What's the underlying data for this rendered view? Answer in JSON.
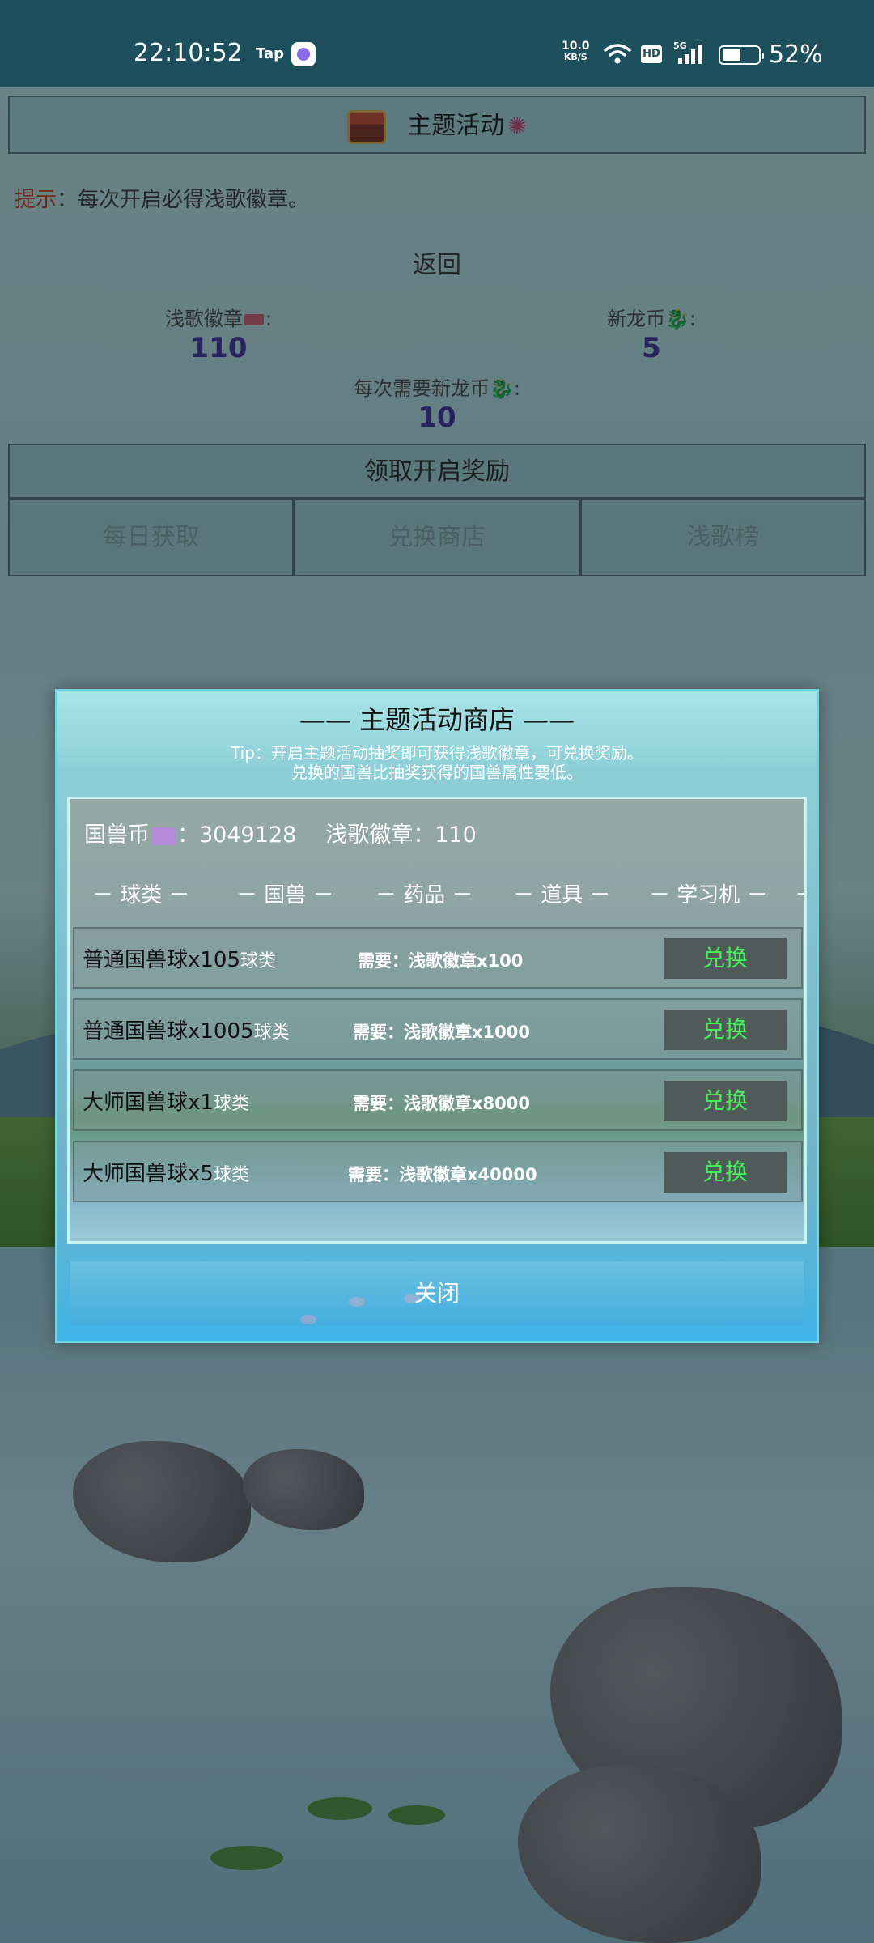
{
  "status_bar": {
    "time": "22:10:52",
    "tap_label": "Tap",
    "net_speed_value": "10.0",
    "net_speed_unit": "KB/S",
    "hd_badge": "HD",
    "signal_label": "5G",
    "battery_percent": "52%",
    "battery_level": 0.52
  },
  "page": {
    "header_title": "主题活动",
    "tip_label": "提示",
    "tip_text": "：每次开启必得浅歌徽章。",
    "back_label": "返回",
    "badge_label": "浅歌徽章",
    "badge_value": "110",
    "dragon_coin_label": "新龙币",
    "dragon_coin_value": "5",
    "cost_label": "每次需要新龙币",
    "cost_value": "10",
    "claim_button": "领取开启奖励",
    "tabs": [
      "每日获取",
      "兑换商店",
      "浅歌榜"
    ]
  },
  "modal": {
    "title": "—— 主题活动商店 ——",
    "tip_line1": "Tip：开启主题活动抽奖即可获得浅歌徽章，可兑换奖励。",
    "tip_line2": "兑换的国兽比抽奖获得的国兽属性要低。",
    "coin_label": "国兽币",
    "coin_value": "：3049128",
    "badge_label": "浅歌徽章：110",
    "categories": [
      "－ 球类 －",
      "－ 国兽 －",
      "－ 药品 －",
      "－ 道具 －",
      "－ 学习机 －",
      "－"
    ],
    "items": [
      {
        "name": "普通国兽球x105",
        "category": "球类",
        "need": "需要：浅歌徽章x100",
        "button": "兑换"
      },
      {
        "name": "普通国兽球x1005",
        "category": "球类",
        "need": "需要：浅歌徽章x1000",
        "button": "兑换"
      },
      {
        "name": "大师国兽球x1",
        "category": "球类",
        "need": "需要：浅歌徽章x8000",
        "button": "兑换"
      },
      {
        "name": "大师国兽球x5",
        "category": "球类",
        "need": "需要：浅歌徽章x40000",
        "button": "兑换"
      }
    ],
    "close_label": "关闭"
  }
}
